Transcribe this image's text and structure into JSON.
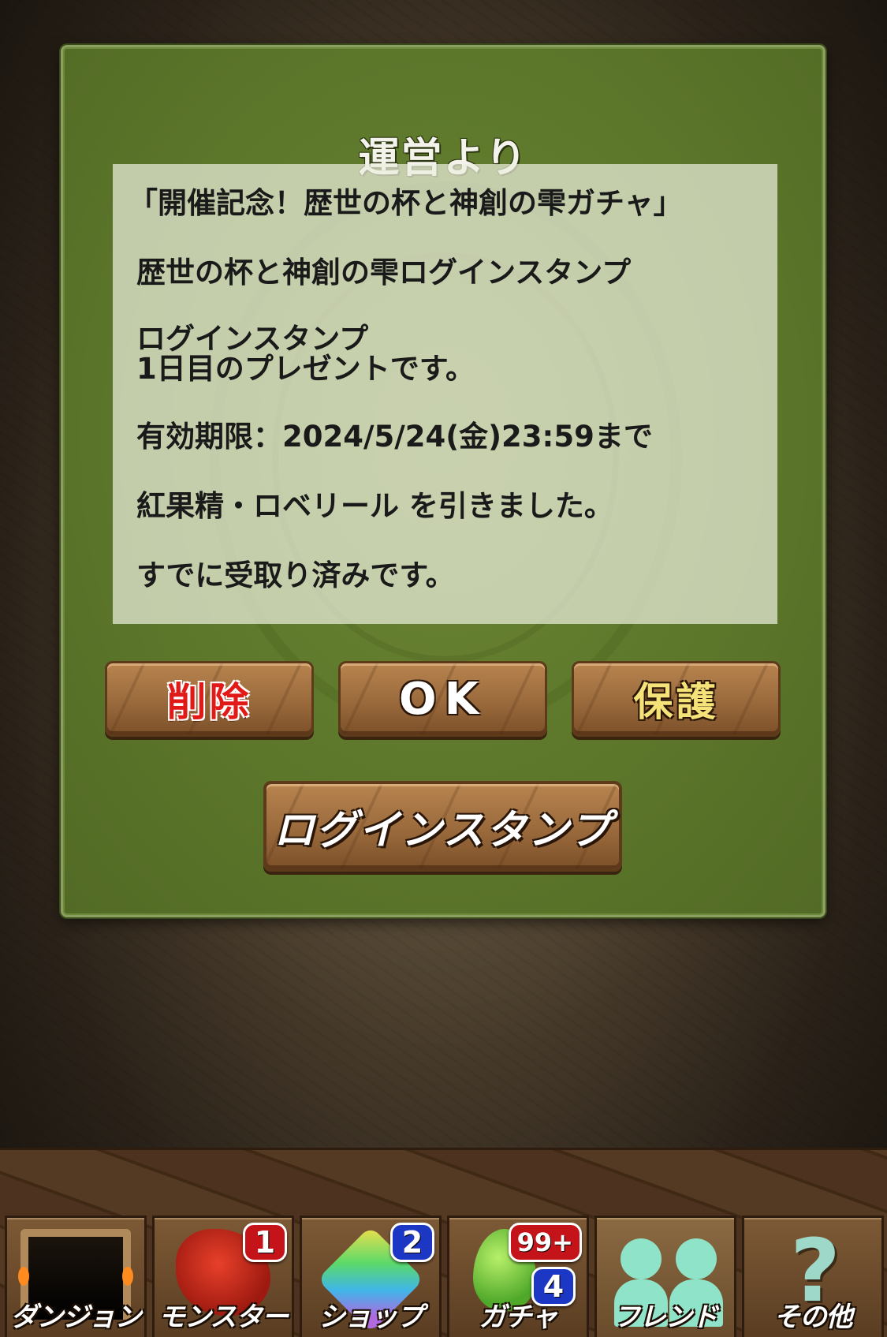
{
  "dialog": {
    "title": "運営より",
    "message": {
      "line1": "「開催記念！歴世の杯と神創の雫ガチャ」",
      "line2": "歴世の杯と神創の雫ログインスタンプ",
      "line3a": "ログインスタンプ",
      "line3b": "1日目のプレゼントです。",
      "line4": "有効期限：2024/5/24(金)23:59まで",
      "line5": "紅果精・ロベリール を引きました。",
      "line6": "すでに受取り済みです。"
    },
    "buttons": {
      "delete": "削除",
      "ok": "OK",
      "protect": "保護",
      "login_stamp": "ログインスタンプ"
    }
  },
  "nav": {
    "items": [
      {
        "label": "ダンジョン",
        "icon": "dungeon-gate-icon"
      },
      {
        "label": "モンスター",
        "icon": "red-dragon-icon",
        "badge": "1"
      },
      {
        "label": "ショップ",
        "icon": "rainbow-gem-icon",
        "badge": "2"
      },
      {
        "label": "ガチャ",
        "icon": "egg-icon",
        "badge": "99+",
        "badge2": "4"
      },
      {
        "label": "フレンド",
        "icon": "friends-icon"
      },
      {
        "label": "その他",
        "icon": "question-mark-icon"
      }
    ]
  },
  "colors": {
    "dialog_green": "#5f7a2c",
    "delete_red": "#e21a17",
    "protect_yellow": "#f5e37a",
    "badge_red": "#c4141a",
    "badge_blue": "#1b37c4"
  }
}
